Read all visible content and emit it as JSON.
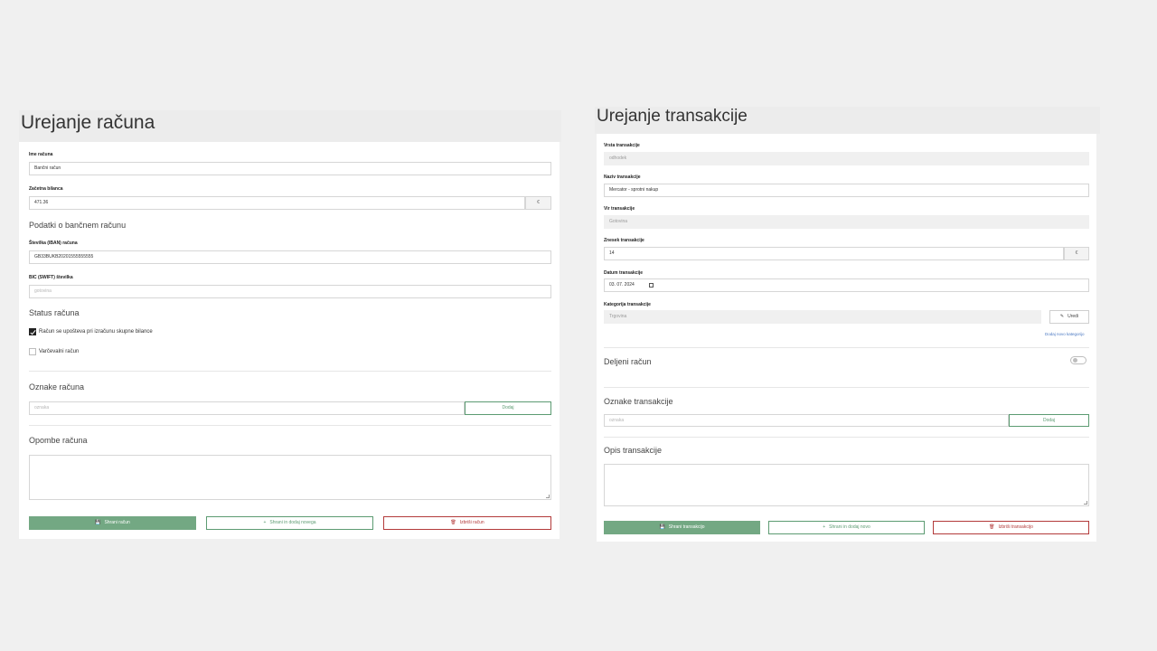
{
  "account": {
    "title": "Urejanje računa",
    "name_label": "Ime računa",
    "name_value": "Bančni račun",
    "balance_label": "Začetna bilanca",
    "balance_value": "471.36",
    "currency": "€",
    "bank_section": "Podatki o bančnem računu",
    "iban_label": "Številka (IBAN) računa",
    "iban_value": "GB33BUKB20201555555555",
    "bic_label": "BIC (SWIFT) številka",
    "bic_placeholder": "gotovina",
    "status_section": "Status računa",
    "check_balance_label": "Račun se upošteva pri izračunu skupne bilance",
    "check_balance_checked": true,
    "check_savings_label": "Varčevalni račun",
    "check_savings_checked": false,
    "tags_section": "Oznake računa",
    "tag_placeholder": "oznaka",
    "add_label": "Dodaj",
    "notes_section": "Opombe računa",
    "save_label": "Shrani račun",
    "save_new_label": "Shrani in dodaj novega",
    "delete_label": "Izbriši račun"
  },
  "transaction": {
    "title": "Urejanje transakcije",
    "type_label": "Vrsta transakcije",
    "type_value": "odhodek",
    "name_label": "Naziv transakcije",
    "name_value": "Mercator - sprotni nakup",
    "source_label": "Vir transakcije",
    "source_value": "Gotovina",
    "amount_label": "Znesek transakcije",
    "amount_value": "14",
    "currency": "€",
    "date_label": "Datum transakcije",
    "date_value": "03. 07. 2024",
    "category_label": "Kategorija transakcije",
    "category_value": "Trgovina",
    "edit_label": "Uredi",
    "add_category_link": "Dodaj novo kategorijo",
    "shared_section": "Deljeni račun",
    "shared_on": false,
    "tags_section": "Oznake transakcije",
    "tag_placeholder": "oznaka",
    "add_label": "Dodaj",
    "desc_section": "Opis transakcije",
    "save_label": "Shrani transakcijo",
    "save_new_label": "Shrani in dodaj novo",
    "delete_label": "Izbriši transakcijo"
  },
  "icons": {
    "save": "floppy-disk-icon",
    "plus": "plus-icon",
    "trash": "trash-icon",
    "pencil": "pencil-icon",
    "calendar": "calendar-icon"
  },
  "colors": {
    "primary_green": "#73a883",
    "outline_green": "#5c9b72",
    "danger_red": "#b33a3a",
    "link_blue": "#4a78c2"
  }
}
